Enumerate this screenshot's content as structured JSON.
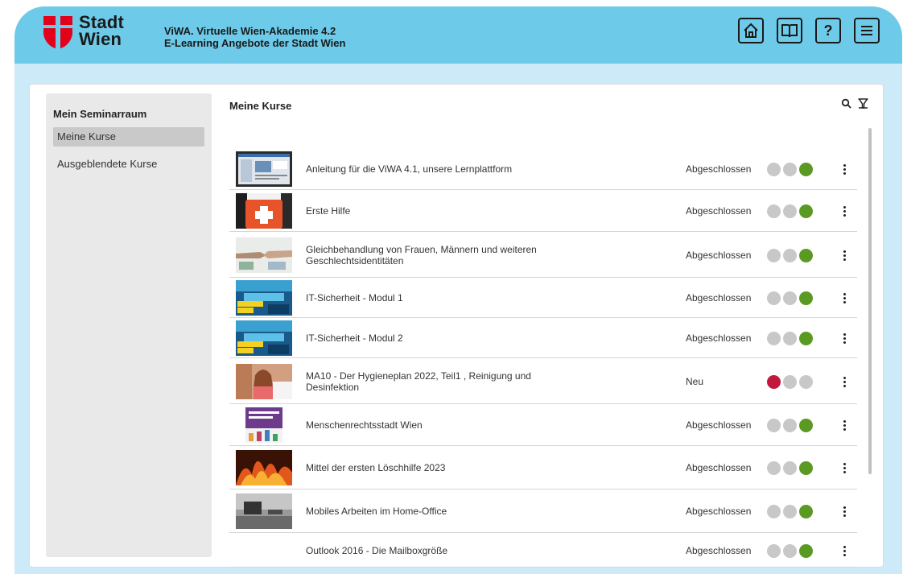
{
  "header": {
    "logo_line1": "Stadt",
    "logo_line2": "Wien",
    "app_title_line1": "ViWA. Virtuelle Wien-Akademie 4.2",
    "app_title_line2": "E-Learning Angebote der Stadt Wien",
    "icons": [
      "home-icon",
      "book-icon",
      "help-icon",
      "menu-icon"
    ],
    "help_glyph": "?"
  },
  "colors": {
    "header_bg": "#6dcae8",
    "page_bg": "#cdeaf8",
    "logo_red": "#e2001a",
    "status_green": "#5a9a22",
    "status_red": "#c4173e",
    "status_grey": "#c8c8c8"
  },
  "sidebar": {
    "title": "Mein Seminarraum",
    "items": [
      {
        "label": "Meine Kurse",
        "active": true
      },
      {
        "label": "Ausgeblendete Kurse",
        "active": false
      }
    ]
  },
  "main": {
    "title": "Meine Kurse",
    "tools": [
      "search-icon",
      "filter-icon"
    ]
  },
  "courses": [
    {
      "title": "Anleitung für die ViWA 4.1, unsere Lernplattform",
      "status": "Abgeschlossen",
      "dots": [
        "grey",
        "grey",
        "green"
      ],
      "thumb": "screen"
    },
    {
      "title": "Erste Hilfe",
      "status": "Abgeschlossen",
      "dots": [
        "grey",
        "grey",
        "green"
      ],
      "thumb": "firstaid"
    },
    {
      "title": "Gleichbehandlung von Frauen, Männern und weiteren Geschlechtsidentitäten",
      "status": "Abgeschlossen",
      "dots": [
        "grey",
        "grey",
        "green"
      ],
      "thumb": "hands"
    },
    {
      "title": "IT-Sicherheit - Modul 1",
      "status": "Abgeschlossen",
      "dots": [
        "grey",
        "grey",
        "green"
      ],
      "thumb": "itsec"
    },
    {
      "title": "IT-Sicherheit - Modul 2",
      "status": "Abgeschlossen",
      "dots": [
        "grey",
        "grey",
        "green"
      ],
      "thumb": "itsec"
    },
    {
      "title": "MA10 - Der Hygieneplan 2022, Teil1 , Reinigung und Desinfektion",
      "status": "Neu",
      "dots": [
        "red",
        "grey",
        "grey"
      ],
      "thumb": "girl"
    },
    {
      "title": "Menschenrechtsstadt Wien",
      "status": "Abgeschlossen",
      "dots": [
        "grey",
        "grey",
        "green"
      ],
      "thumb": "poster"
    },
    {
      "title": "Mittel der ersten Löschhilfe 2023",
      "status": "Abgeschlossen",
      "dots": [
        "grey",
        "grey",
        "green"
      ],
      "thumb": "fire"
    },
    {
      "title": "Mobiles Arbeiten im Home-Office",
      "status": "Abgeschlossen",
      "dots": [
        "grey",
        "grey",
        "green"
      ],
      "thumb": "office"
    },
    {
      "title": "Outlook 2016 - Die Mailboxgröße",
      "status": "Abgeschlossen",
      "dots": [
        "grey",
        "grey",
        "green"
      ],
      "thumb": "none"
    }
  ]
}
